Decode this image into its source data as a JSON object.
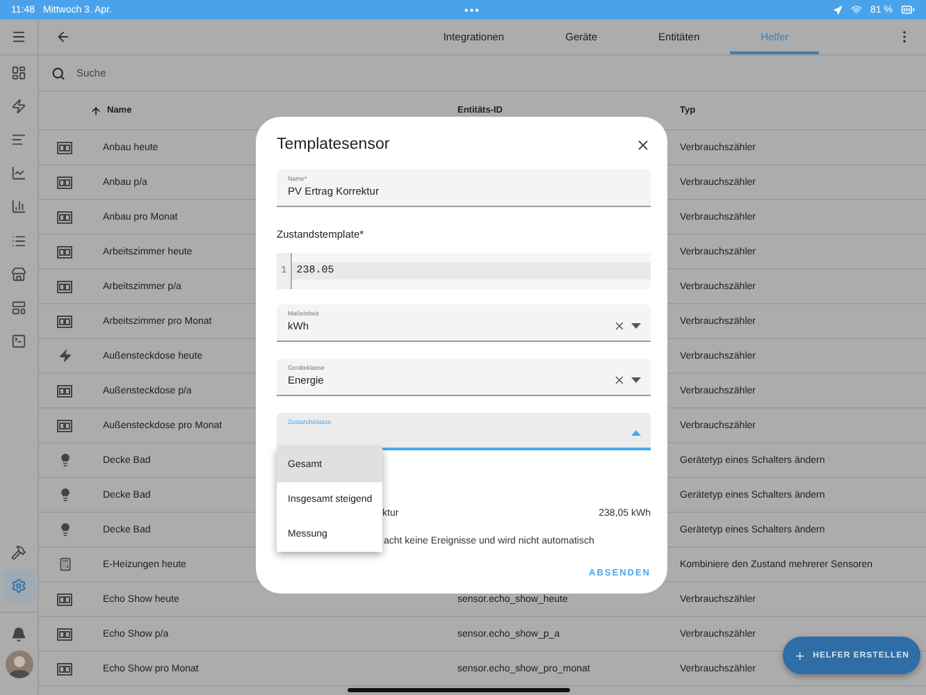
{
  "status_bar": {
    "time": "11:48",
    "date": "Mittwoch 3. Apr.",
    "dots": "•••",
    "battery": "81 %"
  },
  "sidebar": {
    "items": [
      {
        "selected": false
      },
      {
        "selected": false
      },
      {
        "selected": false
      },
      {
        "selected": false
      },
      {
        "selected": false
      },
      {
        "selected": false
      },
      {
        "selected": false
      },
      {
        "selected": false
      },
      {
        "selected": false
      }
    ],
    "bottom_items": [
      {
        "selected": false
      },
      {
        "selected": true
      }
    ]
  },
  "tabs": [
    {
      "label": "Integrationen",
      "selected": false
    },
    {
      "label": "Geräte",
      "selected": false
    },
    {
      "label": "Entitäten",
      "selected": false
    },
    {
      "label": "Helfer",
      "selected": true
    }
  ],
  "search": {
    "placeholder": "Suche"
  },
  "table": {
    "columns": [
      "Name",
      "Entitäts-ID",
      "Typ"
    ],
    "rows": [
      {
        "kind": "meter",
        "name": "Anbau heute",
        "type": "Verbrauchszähler"
      },
      {
        "kind": "meter",
        "name": "Anbau p/a",
        "type": "Verbrauchszähler"
      },
      {
        "kind": "meter",
        "name": "Anbau pro Monat",
        "type": "Verbrauchszähler"
      },
      {
        "kind": "meter",
        "name": "Arbeitszimmer heute",
        "type": "Verbrauchszähler"
      },
      {
        "kind": "meter",
        "name": "Arbeitszimmer p/a",
        "type": "Verbrauchszähler"
      },
      {
        "kind": "meter",
        "name": "Arbeitszimmer pro Monat",
        "type": "Verbrauchszähler"
      },
      {
        "kind": "flash",
        "name": "Außensteckdose heute",
        "type": "Verbrauchszähler"
      },
      {
        "kind": "meter",
        "name": "Außensteckdose p/a",
        "type": "Verbrauchszähler"
      },
      {
        "kind": "meter",
        "name": "Außensteckdose pro Monat",
        "type": "Verbrauchszähler"
      },
      {
        "kind": "bulb",
        "name": "Decke Bad",
        "type": "Gerätetyp eines Schalters ändern"
      },
      {
        "kind": "bulb",
        "name": "Decke Bad",
        "type": "Gerätetyp eines Schalters ändern"
      },
      {
        "kind": "bulb",
        "name": "Decke Bad",
        "type": "Gerätetyp eines Schalters ändern"
      },
      {
        "kind": "calculator",
        "name": "E-Heizungen heute",
        "type": "Kombiniere den Zustand mehrerer Sensoren"
      },
      {
        "kind": "meter",
        "name": "Echo Show heute",
        "entity_id": "sensor.echo_show_heute",
        "type": "Verbrauchszähler"
      },
      {
        "kind": "meter",
        "name": "Echo Show p/a",
        "entity_id": "sensor.echo_show_p_a",
        "type": "Verbrauchszähler"
      },
      {
        "kind": "meter",
        "name": "Echo Show pro Monat",
        "entity_id": "sensor.echo_show_pro_monat",
        "type": "Verbrauchszähler"
      }
    ]
  },
  "dialog": {
    "title": "Templatesensor",
    "fields": [
      {
        "kind": "text",
        "label": "Name*",
        "value": "PV Ertrag Korrektur",
        "focused": false
      },
      {
        "kind": "code",
        "label": "Zustandstemplate*",
        "line_number": "1",
        "value": "238.05"
      },
      {
        "kind": "select",
        "label": "Maßeinheit",
        "value": "kWh",
        "clearable": true,
        "focused": false
      },
      {
        "kind": "select",
        "label": "Geräteklasse",
        "value": "Energie",
        "clearable": true,
        "focused": false
      },
      {
        "kind": "select",
        "label": "Zustandsklasse",
        "clearable": false,
        "focused": true
      }
    ],
    "preview": {
      "name": "ktur",
      "value": "238,05 kWh",
      "note": "acht keine Ereignisse und wird nicht automatisch"
    },
    "menu": [
      {
        "label": "Gesamt",
        "selected": true
      },
      {
        "label": "Insgesamt steigend",
        "selected": false
      },
      {
        "label": "Messung",
        "selected": false
      }
    ],
    "submit": "ABSENDEN"
  },
  "fab": {
    "label": "HELFER ERSTELLEN"
  }
}
